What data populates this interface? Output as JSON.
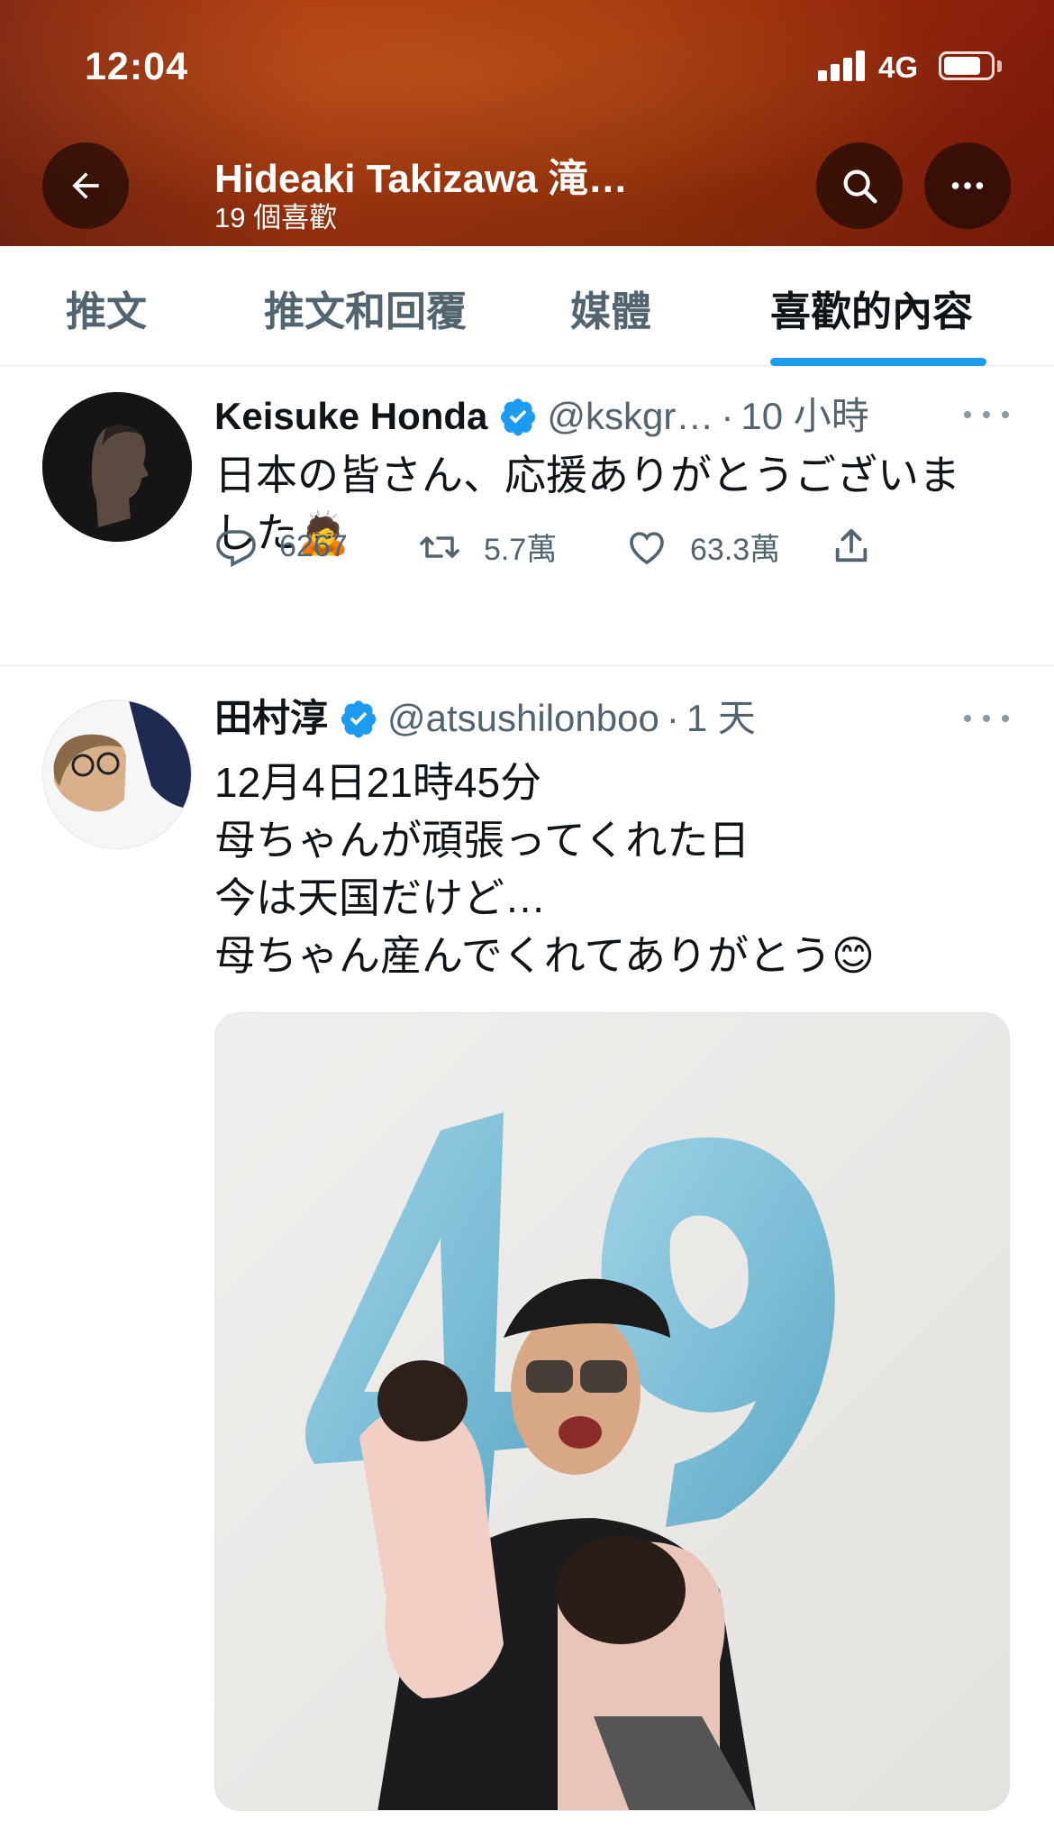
{
  "status_bar": {
    "time": "12:04",
    "network": "4G"
  },
  "header": {
    "title": "Hideaki Takizawa 滝…",
    "subtitle": "19 個喜歡"
  },
  "tabs": [
    {
      "label": "推文",
      "active": false
    },
    {
      "label": "推文和回覆",
      "active": false
    },
    {
      "label": "媒體",
      "active": false
    },
    {
      "label": "喜歡的內容",
      "active": true
    }
  ],
  "colors": {
    "accent": "#1d9bf0",
    "header_bg": "#a8380c",
    "secondary_text": "#536471"
  },
  "tweets": [
    {
      "name": "Keisuke Honda",
      "handle": "@kskgr…",
      "dot": "·",
      "time": "10 小時",
      "lines": [
        "日本の皆さん、応援ありがとうございま",
        "した🙇"
      ],
      "replies": "6267",
      "retweets": "5.7萬",
      "likes": "63.3萬"
    },
    {
      "name": "田村淳",
      "handle": "@atsushilonboo",
      "dot": "·",
      "time": "1 天",
      "lines": [
        "12月4日21時45分",
        "母ちゃんが頑張ってくれた日",
        "今は天国だけど…",
        "母ちゃん産んでくれてありがとう😊"
      ]
    }
  ]
}
